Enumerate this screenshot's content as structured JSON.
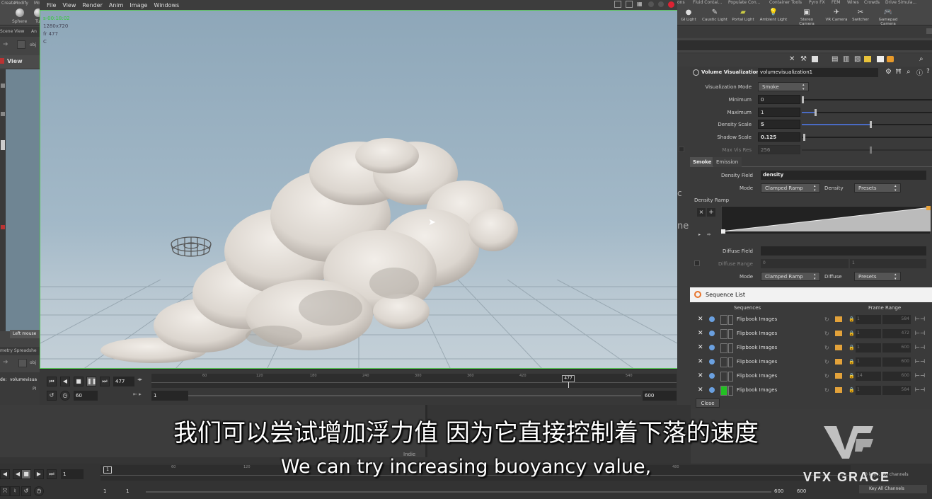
{
  "viewer": {
    "menu": [
      "File",
      "View",
      "Render",
      "Anim",
      "Image",
      "Windows"
    ],
    "overlay_time": "s-00:18:02",
    "overlay_res": "1280x720",
    "overlay_frame": "fr 477",
    "overlay_c": "C"
  },
  "left": {
    "shelf_tools": [
      "Sphere",
      "Tu"
    ],
    "tabs": [
      "Create",
      "Modify",
      "Mo"
    ],
    "pane_tabs": [
      "Scene View",
      "An"
    ],
    "path": "obj",
    "view_label": "View",
    "status": "Left mouse",
    "spreadsheet_tab": "metry Spreadshe",
    "node_label": "de:",
    "node_value": "volumevisua",
    "pi": "PI"
  },
  "shelf_right": {
    "tabs": [
      "ons",
      "Fluid Contai...",
      "Populate Con...",
      "Container Tools",
      "Pyro FX",
      "FEM",
      "Wires",
      "Crowds",
      "Drive Simula..."
    ],
    "tools": [
      {
        "label": "GI Light",
        "icon": "gi-light-icon"
      },
      {
        "label": "Caustic Light",
        "icon": "caustic-light-icon"
      },
      {
        "label": "Portal Light",
        "icon": "portal-light-icon"
      },
      {
        "label": "Ambient Light",
        "icon": "ambient-light-icon"
      },
      {
        "label": "Stereo Camera",
        "icon": "stereo-camera-icon"
      },
      {
        "label": "VR Camera",
        "icon": "vr-camera-icon"
      },
      {
        "label": "Switcher",
        "icon": "switcher-icon"
      },
      {
        "label": "Gamepad Camera",
        "icon": "gamepad-camera-icon"
      }
    ]
  },
  "params": {
    "node_type": "Volume Visualization",
    "node_name": "volumevisualization1",
    "visualization_mode_label": "Visualization Mode",
    "visualization_mode": "Smoke",
    "minimum_label": "Minimum",
    "minimum": "0",
    "maximum_label": "Maximum",
    "maximum": "1",
    "density_scale_label": "Density Scale",
    "density_scale": "5",
    "shadow_scale_label": "Shadow Scale",
    "shadow_scale": "0.125",
    "max_vis_res_label": "Max Vis Res",
    "max_vis_res": "256",
    "tabs": [
      "Smoke",
      "Emission"
    ],
    "density_field_label": "Density Field",
    "density_field": "density",
    "mode_label": "Mode",
    "density_mode": "Clamped Ramp",
    "density_label": "Density",
    "presets": "Presets",
    "density_ramp_label": "Density Ramp",
    "diffuse_field_label": "Diffuse Field",
    "diffuse_field": "",
    "diffuse_range_label": "Diffuse Range",
    "diffuse_range_a": "0",
    "diffuse_range_b": "1",
    "diffuse_mode": "Clamped Ramp",
    "diffuse_label": "Diffuse",
    "diffuse_presets": "Presets",
    "side_c": "c",
    "side_ne": "ne"
  },
  "sequence_list": {
    "title": "Sequence List",
    "col_sequences": "Sequences",
    "col_frame_range": "Frame Range",
    "rows": [
      {
        "name": "Flipbook Images",
        "start": "1",
        "end": "584",
        "color": "#3a3a3a"
      },
      {
        "name": "Flipbook Images",
        "start": "1",
        "end": "472",
        "color": "#3a3a3a"
      },
      {
        "name": "Flipbook Images",
        "start": "1",
        "end": "600",
        "color": "#3a3a3a"
      },
      {
        "name": "Flipbook Images",
        "start": "1",
        "end": "600",
        "color": "#3a3a3a"
      },
      {
        "name": "Flipbook Images",
        "start": "14",
        "end": "600",
        "color": "#3a3a3a"
      },
      {
        "name": "Flipbook Images",
        "start": "1",
        "end": "584",
        "color": "#22c022"
      }
    ],
    "close": "Close"
  },
  "timeline": {
    "current_frame": "477",
    "fps": "60",
    "start": "1",
    "end": "600",
    "ticks": [
      "60",
      "120",
      "180",
      "240",
      "300",
      "360",
      "420",
      "480",
      "540"
    ],
    "marker": "477"
  },
  "bottom_timeline": {
    "frame": "1",
    "marker": "1",
    "ticks": [
      "60",
      "120",
      "480"
    ],
    "start_a": "1",
    "start_b": "1",
    "end_a": "600",
    "end_b": "600",
    "indie": "Indie",
    "channels": "0 keys, 0/0 channels",
    "key_all": "Key All Channels"
  },
  "subtitles": {
    "chinese": "我们可以尝试增加浮力值 因为它直接控制着下落的速度",
    "english": "We can try increasing buoyancy value,"
  },
  "logo": {
    "mark": "VG",
    "text": "VFX GRACE"
  }
}
